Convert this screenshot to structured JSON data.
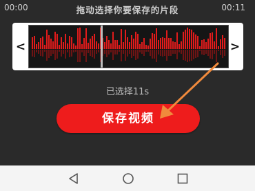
{
  "header": {
    "time_start": "00:00",
    "hint": "拖动选择你要保存的片段",
    "time_end": "00:11"
  },
  "trim": {
    "prev_icon": "chevron-left-icon",
    "next_icon": "chevron-right-icon",
    "prev_glyph": "<",
    "next_glyph": ">"
  },
  "selected_label": "已选择11s",
  "save_button": "保存视频",
  "colors": {
    "accent": "#ee1c1c",
    "wave_bar": "#e11b1b",
    "wave_reflection": "#6e1414",
    "pointer_arrow": "#f08a3c"
  },
  "navbar": {
    "back_icon": "back-triangle-icon",
    "home_icon": "home-circle-icon",
    "recent_icon": "recent-square-icon"
  }
}
